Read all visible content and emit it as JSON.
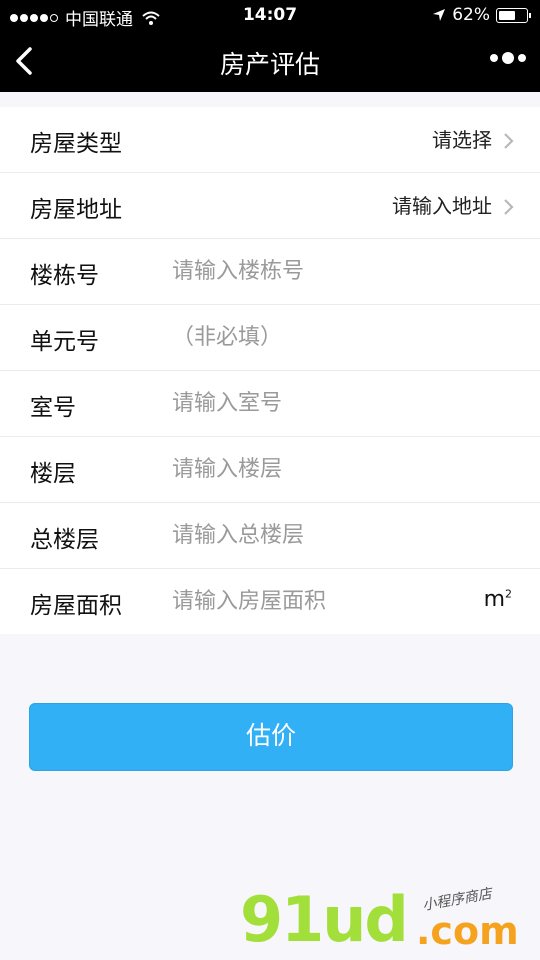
{
  "status_bar": {
    "carrier": "中国联通",
    "time": "14:07",
    "battery": "62%",
    "signal_bars_filled": 4,
    "signal_bars_total": 5,
    "battery_level": 0.62
  },
  "nav": {
    "title": "房产评估",
    "back_icon": "chevron-left-icon",
    "more_icon": "more-dots-icon"
  },
  "form": {
    "rows": [
      {
        "label": "房屋类型",
        "value": "请选择"
      },
      {
        "label": "房屋地址",
        "value": "请输入地址"
      },
      {
        "label": "楼栋号",
        "placeholder": "请输入楼栋号"
      },
      {
        "label": "单元号",
        "placeholder": "（非必填）"
      },
      {
        "label": "室号",
        "placeholder": "请输入室号"
      },
      {
        "label": "楼层",
        "placeholder": "请输入楼层"
      },
      {
        "label": "总楼层",
        "placeholder": "请输入总楼层"
      },
      {
        "label": "房屋面积",
        "placeholder": "请输入房屋面积",
        "unit": "m",
        "unit_sup": "2"
      }
    ]
  },
  "estimate_button": "估价",
  "watermark": {
    "logo": "91ud",
    "suffix": ".com",
    "tagline": "小程序商店"
  },
  "colors": {
    "accent": "#31b0f6",
    "navbar_bg": "#000000",
    "page_bg": "#f7f6fa"
  }
}
